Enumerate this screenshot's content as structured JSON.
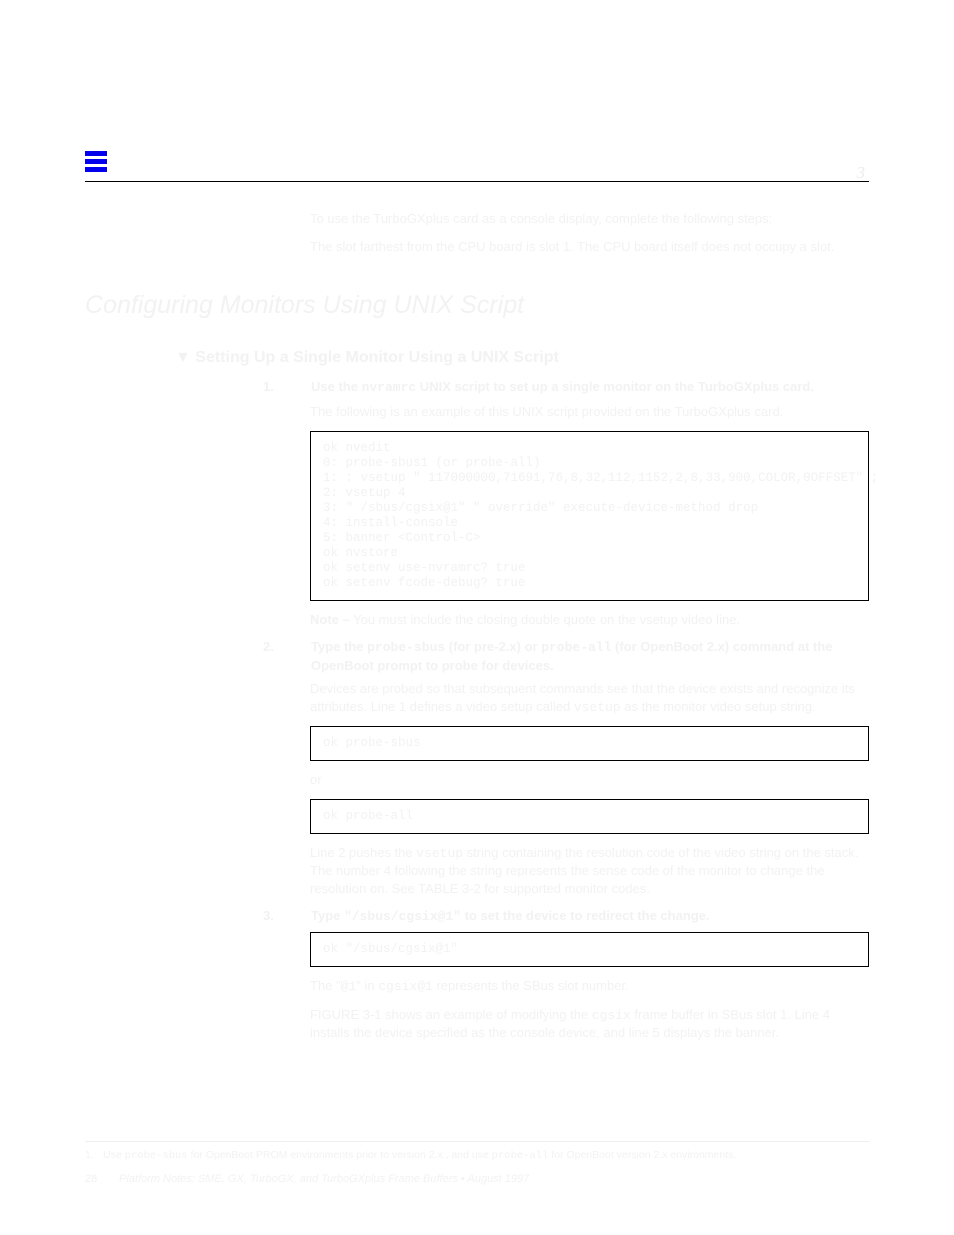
{
  "header": {
    "chapter": "3"
  },
  "intro": {
    "p1": "To use the TurboGXplus card as a console display, complete the following steps:",
    "p2": "The slot farthest from the CPU board is slot 1. The CPU board itself does not occupy a slot."
  },
  "h2": "Configuring Monitors Using UNIX Script",
  "h3_1": "▼ Setting Up a Single Monitor Using a UNIX Script",
  "step1": {
    "num": "1.",
    "text_a": "Use the ",
    "code": "nvramrc",
    "text_b": " UNIX script to set up a single monitor on the TurboGXplus card."
  },
  "p_after_step1": "The following is an example of this UNIX script provided on the TurboGXplus card.",
  "code1": "ok nvedit\n0: probe-sbus1 (or probe-all)\n1: : vsetup \" 117000000,71691,76,8,32,112,1152,2,8,33,900,COLOR,0OFFSET\" ;\n2: vsetup 4\n3: \" /sbus/cgsix@1\" \" override\" execute-device-method drop\n4: install-console\n5: banner <Control-C>\nok nvstore\nok setenv use-nvramrc? true\nok setenv fcode-debug? true",
  "note_a_label": "Note –",
  "note_a_text": "You must include the closing double quote on the vsetup video line.",
  "step2": {
    "num": "2.",
    "text_a": "Type the ",
    "code": "probe-sbus",
    "text_b": " (for pre-2.x) or ",
    "code2": "probe-all",
    "text_c": " (for OpenBoot 2.x) command at the OpenBoot prompt to probe for devices."
  },
  "p_after_step2_a": "Devices are probed so that subsequent commands see that the device exists and recognize its attributes. Line 1 defines a video setup called ",
  "p_after_step2_code": "vsetup",
  "p_after_step2_b": " as the monitor video setup string.",
  "code2": "ok probe-sbus",
  "p_or": "or",
  "code3": "ok probe-all",
  "p_line2_a": "Line 2 pushes the ",
  "p_line2_code": "vsetup",
  "p_line2_b": " string containing the resolution code of the video string on the stack. The number 4 following the string represents the sense code of the monitor to change the resolution on. See TABLE 3-2 for supported monitor codes.",
  "step3": {
    "num": "3.",
    "text_a": "Type ",
    "code": "\"/sbus/cgsix@1\"",
    "text_b": " to set the device to redirect the change."
  },
  "code4": "ok \"/sbus/cgsix@1\"",
  "p_cgsix_a": "The \"",
  "p_cgsix_code_a": "@1",
  "p_cgsix_b": "\" in ",
  "p_cgsix_code_b": "cgsix@1",
  "p_cgsix_c": " represents the SBus slot number.",
  "p_figure_a": "FIGURE 3-1 shows an example of modifying the ",
  "p_figure_code": "cgsix",
  "p_figure_b": " frame buffer in SBus slot 1. Line 4 installs the device specified as the console device, and line 5 displays the banner.",
  "footnote": {
    "num": "1.",
    "text_a": "Use ",
    "code_a": "probe-sbus",
    "text_b": " for OpenBoot PROM environments prior to version 2.x., and use ",
    "code_b": "probe-all",
    "text_c": " for OpenBoot version 2.x environments."
  },
  "footer": {
    "page": "28",
    "title": "Platform Notes: SME, GX, TurboGX, and TurboGXplus Frame Buffers • August 1997"
  }
}
